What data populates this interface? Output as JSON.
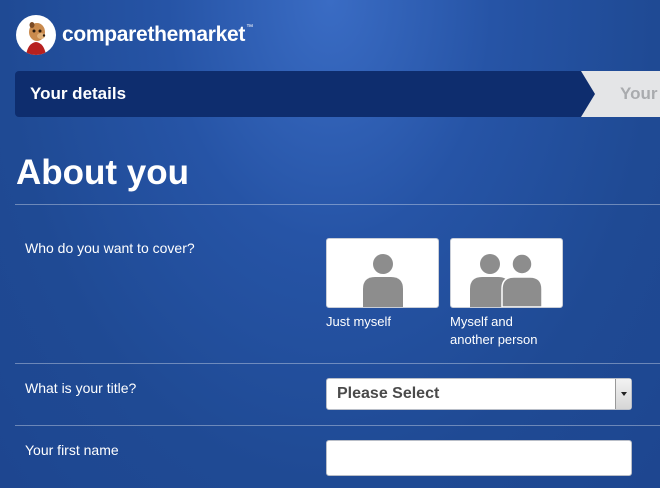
{
  "brand": {
    "name": "comparethemarket",
    "trademark": "™"
  },
  "progress": {
    "current_step": "Your details",
    "next_step": "Your q"
  },
  "page": {
    "heading": "About you"
  },
  "cover": {
    "question": "Who do you want to cover?",
    "options": [
      {
        "caption_line1": "Just myself",
        "caption_line2": "",
        "icon": "single-person-icon"
      },
      {
        "caption_line1": "Myself and",
        "caption_line2": "another person",
        "icon": "two-people-icon"
      }
    ]
  },
  "title_field": {
    "question": "What is your title?",
    "value": "Please Select"
  },
  "first_name_field": {
    "question": "Your first name",
    "value": "",
    "placeholder": ""
  },
  "colors": {
    "background": "#2654a6",
    "active_step": "#0e2d6e",
    "inactive_step_text": "#a9abae",
    "icon_grey": "#8d8d8d"
  }
}
